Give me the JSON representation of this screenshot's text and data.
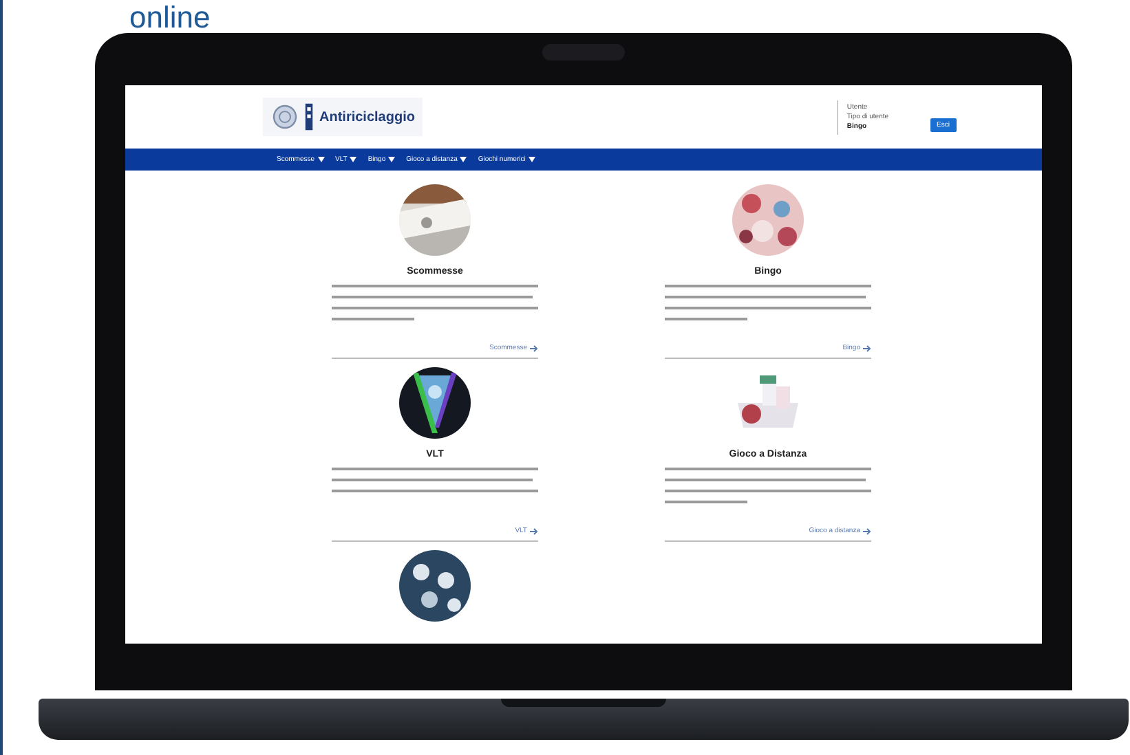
{
  "heading": "online",
  "site": {
    "logo_text": "Antiriciclaggio",
    "user_panel": {
      "label": "Utente",
      "user_type": "Tipo di utente",
      "role": "Bingo",
      "button": "Esci"
    },
    "nav": [
      {
        "label": "Scommesse"
      },
      {
        "label": "VLT"
      },
      {
        "label": "Bingo"
      },
      {
        "label": "Gioco a distanza"
      },
      {
        "label": "Giochi numerici"
      }
    ],
    "cards": [
      {
        "title": "Scommesse",
        "link": "Scommesse"
      },
      {
        "title": "Bingo",
        "link": "Bingo"
      },
      {
        "title": "VLT",
        "link": "VLT"
      },
      {
        "title": "Gioco a Distanza",
        "link": "Gioco a distanza"
      }
    ]
  }
}
